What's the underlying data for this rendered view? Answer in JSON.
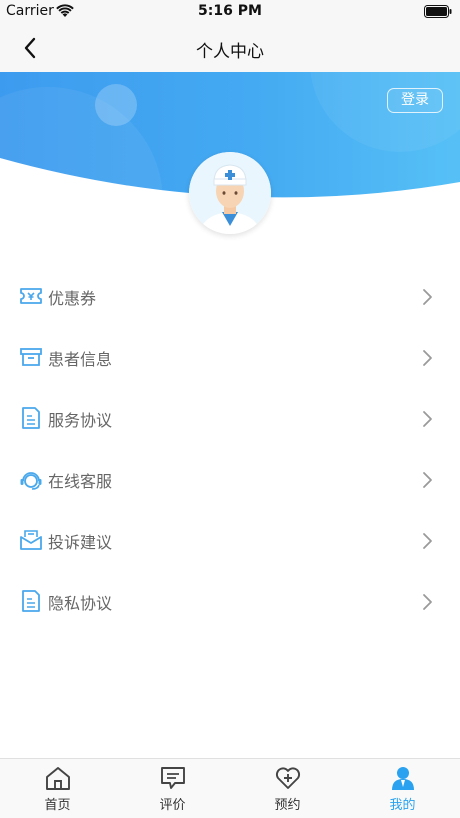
{
  "status_bar": {
    "carrier": "Carrier",
    "time": "5:16 PM"
  },
  "nav": {
    "title": "个人中心",
    "back_icon": "chevron-left-icon"
  },
  "header": {
    "login_label": "登录",
    "avatar_icon": "doctor-avatar-icon",
    "accent_color": "#3fa6ee"
  },
  "menu": {
    "items": [
      {
        "label": "优惠券",
        "icon": "coupon-icon"
      },
      {
        "label": "患者信息",
        "icon": "archive-box-icon"
      },
      {
        "label": "服务协议",
        "icon": "document-icon"
      },
      {
        "label": "在线客服",
        "icon": "headset-icon"
      },
      {
        "label": "投诉建议",
        "icon": "envelope-icon"
      },
      {
        "label": "隐私协议",
        "icon": "document-icon"
      }
    ]
  },
  "tabs": {
    "items": [
      {
        "label": "首页",
        "icon": "home-icon"
      },
      {
        "label": "评价",
        "icon": "comment-icon"
      },
      {
        "label": "预约",
        "icon": "heart-plus-icon"
      },
      {
        "label": "我的",
        "icon": "user-icon"
      }
    ],
    "active_index": 3,
    "active_color": "#2aa2f0"
  }
}
